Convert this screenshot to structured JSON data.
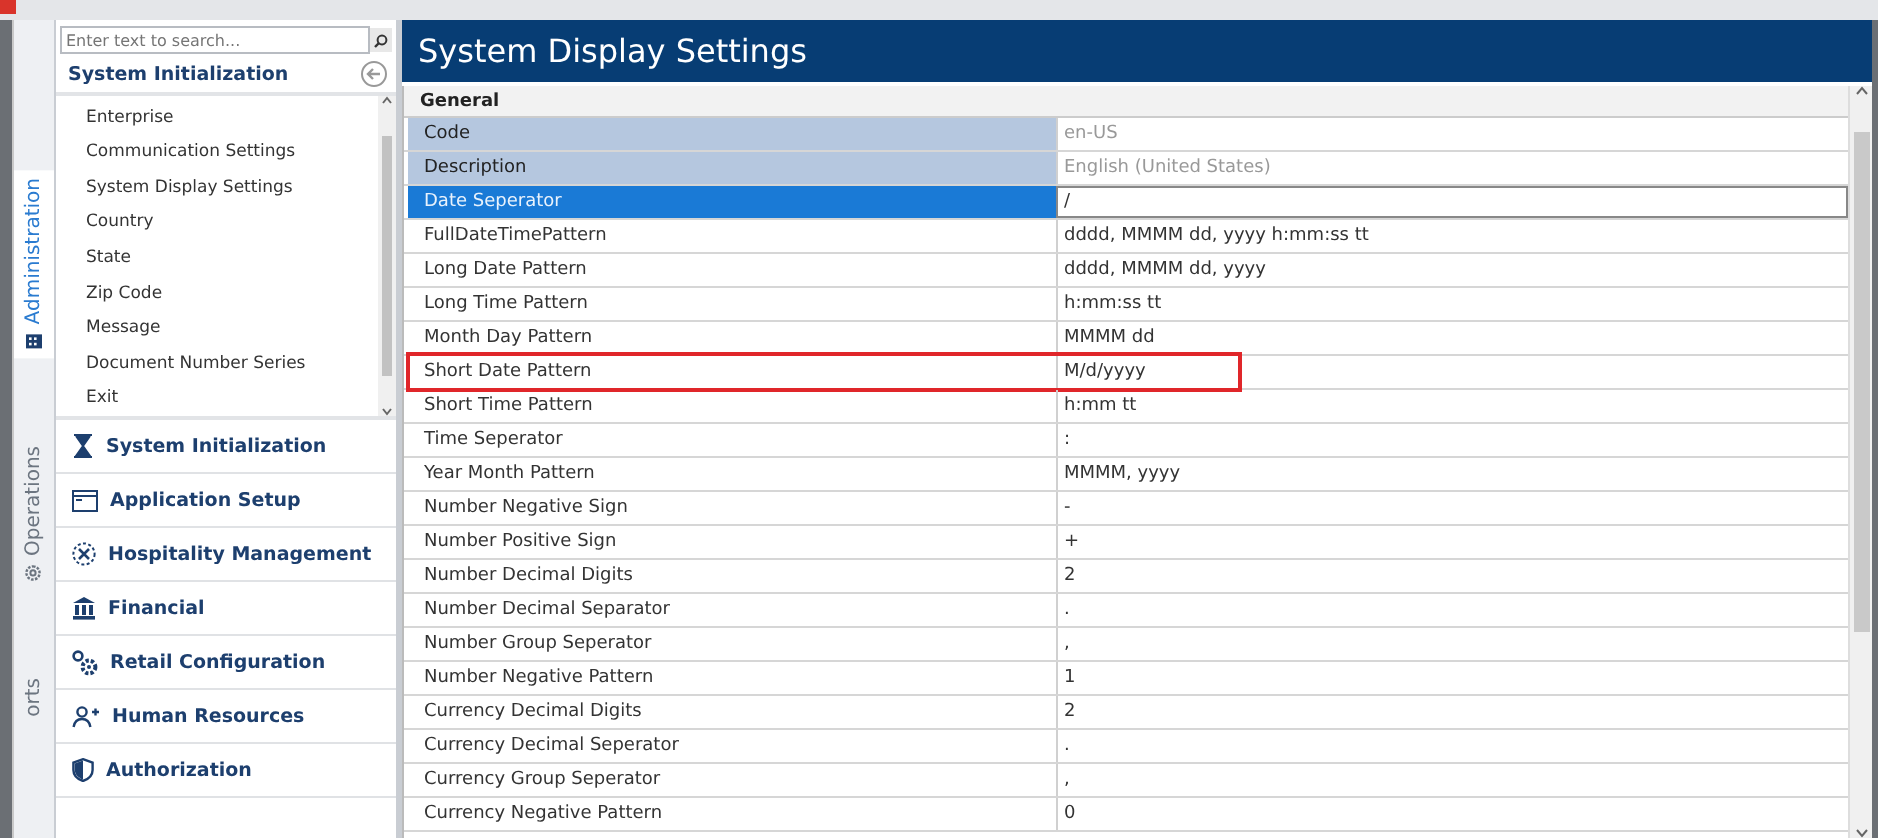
{
  "side_tabs": [
    {
      "label": "Administration",
      "selected": true
    },
    {
      "label": "Operations",
      "selected": false
    },
    {
      "label": "orts",
      "selected": false
    }
  ],
  "sidebar": {
    "search": {
      "placeholder": "Enter text to search..."
    },
    "header": "System Initialization",
    "items": [
      {
        "label": "Enterprise",
        "selected": false
      },
      {
        "label": "Communication Settings",
        "selected": false
      },
      {
        "label": "System Display Settings",
        "selected": false
      },
      {
        "label": "Country",
        "selected": false
      },
      {
        "label": "State",
        "selected": false
      },
      {
        "label": "Zip Code",
        "selected": false
      },
      {
        "label": "Message",
        "selected": false
      },
      {
        "label": "Document Number Series",
        "selected": false
      },
      {
        "label": "Exit",
        "selected": false
      }
    ],
    "modules": [
      {
        "label": "System Initialization"
      },
      {
        "label": "Application Setup"
      },
      {
        "label": "Hospitality Management"
      },
      {
        "label": "Financial"
      },
      {
        "label": "Retail Configuration"
      },
      {
        "label": "Human Resources"
      },
      {
        "label": "Authorization"
      }
    ]
  },
  "main": {
    "title": "System Display Settings",
    "section": "General",
    "rows": [
      {
        "name": "Code",
        "value": "en-US",
        "kind": "readonly",
        "selected": false,
        "highlighted": false
      },
      {
        "name": "Description",
        "value": "English (United States)",
        "kind": "readonly",
        "selected": false,
        "highlighted": false
      },
      {
        "name": "Date Seperator",
        "value": "/",
        "kind": "editable",
        "selected": true,
        "highlighted": false
      },
      {
        "name": "FullDateTimePattern",
        "value": "dddd, MMMM dd, yyyy h:mm:ss tt",
        "kind": "editable",
        "selected": false,
        "highlighted": false
      },
      {
        "name": "Long Date Pattern",
        "value": "dddd, MMMM dd, yyyy",
        "kind": "editable",
        "selected": false,
        "highlighted": false
      },
      {
        "name": "Long Time Pattern",
        "value": "h:mm:ss tt",
        "kind": "editable",
        "selected": false,
        "highlighted": false
      },
      {
        "name": "Month Day Pattern",
        "value": "MMMM dd",
        "kind": "editable",
        "selected": false,
        "highlighted": false
      },
      {
        "name": "Short Date Pattern",
        "value": "M/d/yyyy",
        "kind": "editable",
        "selected": false,
        "highlighted": true
      },
      {
        "name": "Short Time Pattern",
        "value": "h:mm tt",
        "kind": "editable",
        "selected": false,
        "highlighted": false
      },
      {
        "name": "Time Seperator",
        "value": ":",
        "kind": "editable",
        "selected": false,
        "highlighted": false
      },
      {
        "name": "Year Month Pattern",
        "value": "MMMM, yyyy",
        "kind": "editable",
        "selected": false,
        "highlighted": false
      },
      {
        "name": "Number Negative Sign",
        "value": "-",
        "kind": "editable",
        "selected": false,
        "highlighted": false
      },
      {
        "name": "Number Positive Sign",
        "value": "+",
        "kind": "editable",
        "selected": false,
        "highlighted": false
      },
      {
        "name": "Number Decimal Digits",
        "value": "2",
        "kind": "editable",
        "selected": false,
        "highlighted": false
      },
      {
        "name": "Number Decimal Separator",
        "value": ".",
        "kind": "editable",
        "selected": false,
        "highlighted": false
      },
      {
        "name": "Number Group Seperator",
        "value": ",",
        "kind": "editable",
        "selected": false,
        "highlighted": false
      },
      {
        "name": "Number Negative Pattern",
        "value": "1",
        "kind": "editable",
        "selected": false,
        "highlighted": false
      },
      {
        "name": "Currency Decimal Digits",
        "value": "2",
        "kind": "editable",
        "selected": false,
        "highlighted": false
      },
      {
        "name": "Currency Decimal Seperator",
        "value": ".",
        "kind": "editable",
        "selected": false,
        "highlighted": false
      },
      {
        "name": "Currency Group Seperator",
        "value": ",",
        "kind": "editable",
        "selected": false,
        "highlighted": false
      },
      {
        "name": "Currency Negative Pattern",
        "value": "0",
        "kind": "editable",
        "selected": false,
        "highlighted": false
      }
    ]
  }
}
